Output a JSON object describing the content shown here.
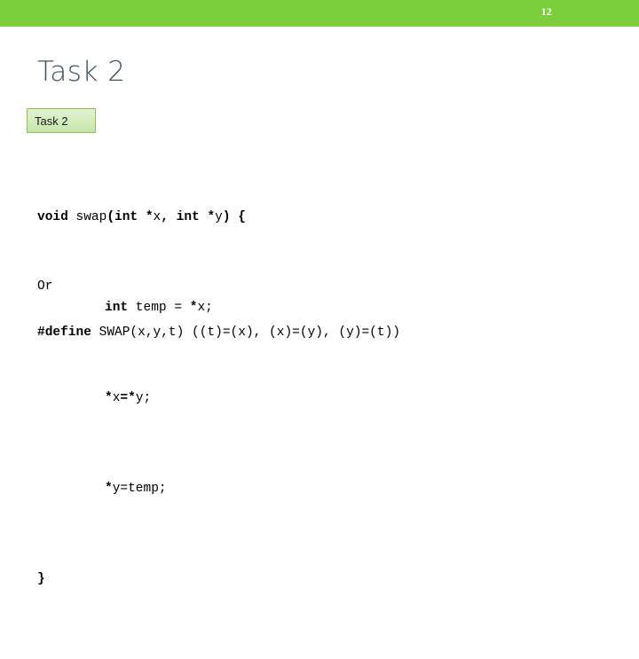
{
  "slide": {
    "page_number": "12",
    "title": "Task 2",
    "banner_color": "#7DCE3C",
    "title_color": "#44505E"
  },
  "label_chip": {
    "text": "Task 2",
    "fill_top": "#E2F3D2",
    "fill_bottom": "#C6E5AA",
    "border_color": "#8FBF5F"
  },
  "code": {
    "line1": {
      "p1": "void",
      "p2": " swap",
      "p3": "(int *",
      "p4": "x",
      "p5": ", int *",
      "p6": "y",
      "p7": ") {"
    },
    "line2": {
      "p1": "int",
      "p2": " temp = ",
      "p3": "*",
      "p4": "x;"
    },
    "line3": {
      "p1": "*",
      "p2": "x",
      "p3": "=*",
      "p4": "y;"
    },
    "line4": {
      "p1": "*",
      "p2": "y=temp;"
    },
    "line5": {
      "p1": "}"
    }
  },
  "or_text": "Or",
  "define": {
    "p1": "#define",
    "p2": " SWAP(x,y,t) ((t)=(x), (x)=(y), (y)=(t))"
  }
}
